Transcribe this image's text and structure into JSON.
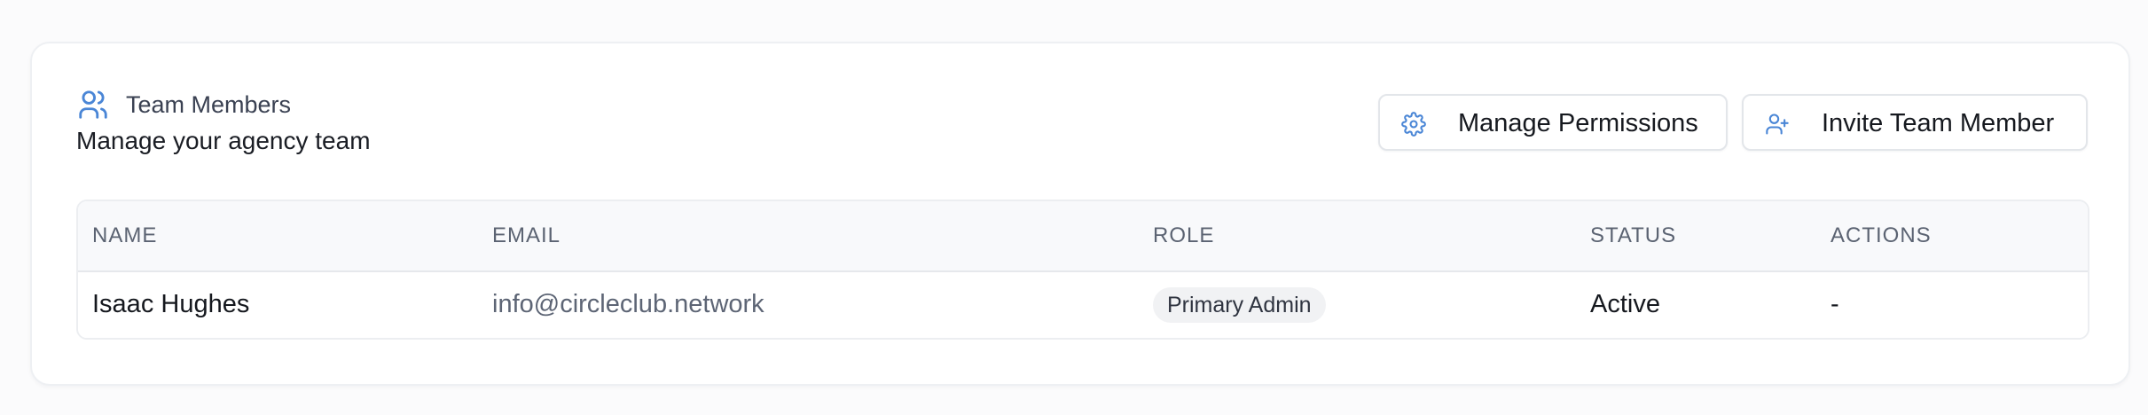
{
  "header": {
    "title": "Team Members",
    "subtitle": "Manage your agency team",
    "icon": "users-icon"
  },
  "actions": {
    "manage_permissions_label": "Manage Permissions",
    "manage_permissions_icon": "gear-icon",
    "invite_label": "Invite Team Member",
    "invite_icon": "user-plus-icon"
  },
  "table": {
    "columns": [
      "NAME",
      "EMAIL",
      "ROLE",
      "STATUS",
      "ACTIONS"
    ],
    "rows": [
      {
        "name": "Isaac Hughes",
        "email": "info@circleclub.network",
        "role": "Primary Admin",
        "status": "Active",
        "actions": "-"
      }
    ]
  },
  "colors": {
    "accent_icon": "#4a86d6",
    "card_bg": "#ffffff",
    "page_bg": "#fbfbfc",
    "table_header_bg": "#f8f9fb",
    "badge_bg": "#f1f2f4"
  }
}
